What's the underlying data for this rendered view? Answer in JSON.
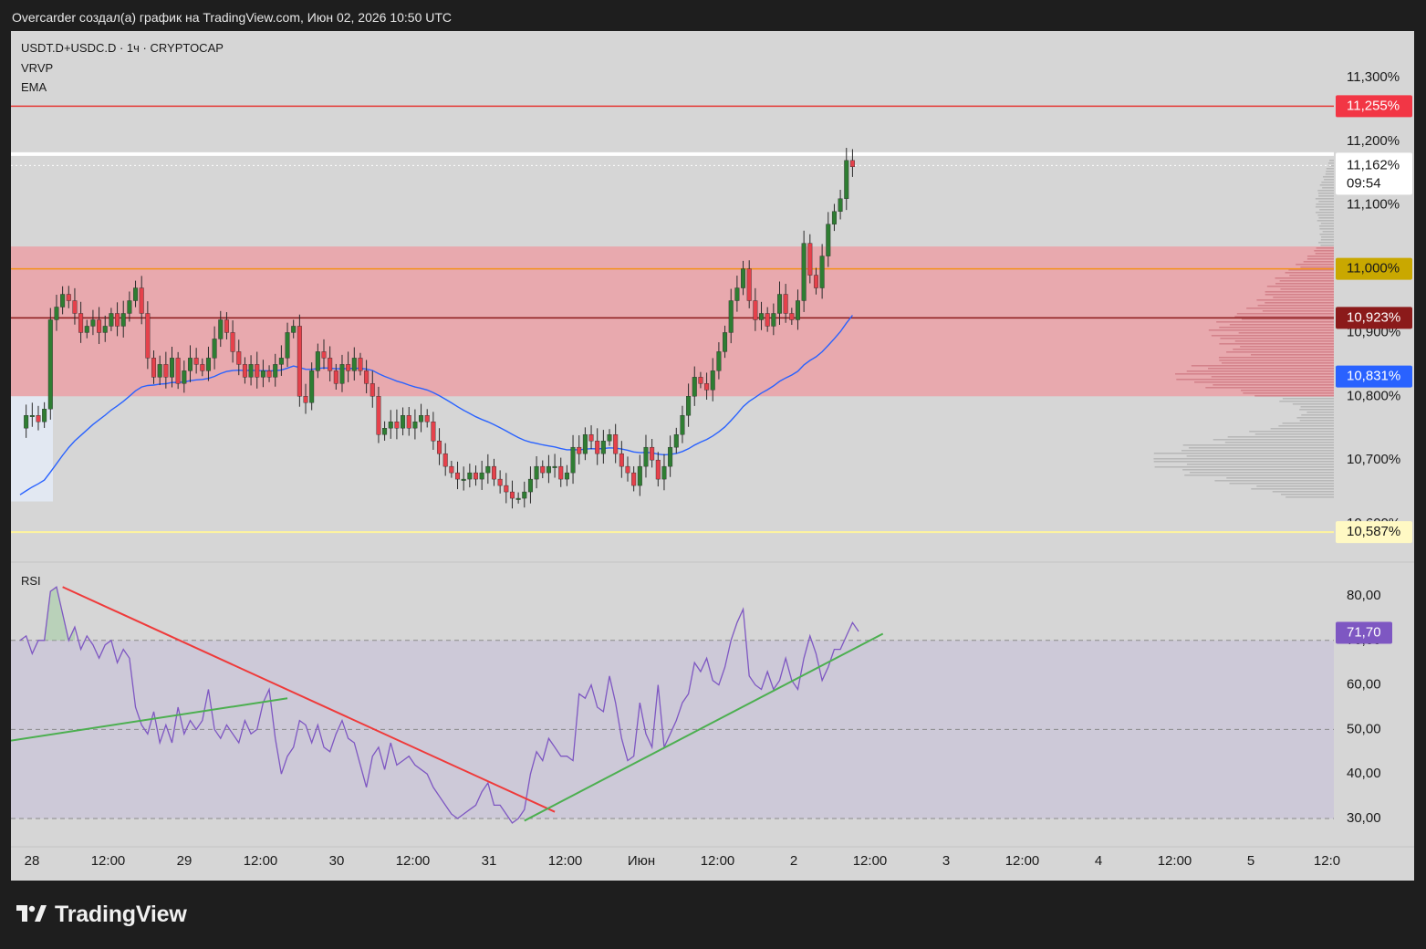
{
  "header": {
    "attribution": "Overcarder создал(а) график на TradingView.com, Июн 02, 2026 10:50 UTC"
  },
  "legend": {
    "symbol": "USDT.D+USDC.D · 1ч · CRYPTOCAP",
    "indicator_1": "VRVP",
    "indicator_2": "EMA",
    "rsi_label": "RSI"
  },
  "footer": {
    "brand": "TradingView"
  },
  "colors": {
    "panel_bg": "#d6d6d6",
    "up": "#2e7d32",
    "down": "#e5414b",
    "ema": "#2962ff",
    "rsi": "#7e57c2",
    "resistance_zone": "#f48a93",
    "line_11255": "#e53935",
    "line_11000": "#f5921b",
    "line_10923": "#8b1a1a",
    "line_10587": "#fff59d",
    "trend_red": "#ef3a3a",
    "trend_green": "#4caf50"
  },
  "chart_data": [
    {
      "type": "candlestick",
      "symbol": "USDT.D+USDC.D",
      "interval": "1ч",
      "exchange": "CRYPTOCAP",
      "y_unit": "%",
      "ylim": [
        10.6,
        11.32
      ],
      "price_ticks": [
        "11,300%",
        "11,200%",
        "11,100%",
        "11,000%",
        "10,900%",
        "10,800%",
        "10,700%",
        "10,600%"
      ],
      "time_ticks": [
        "28",
        "12:00",
        "29",
        "12:00",
        "30",
        "12:00",
        "31",
        "12:00",
        "Июн",
        "12:00",
        "2",
        "12:00",
        "3",
        "12:00",
        "4",
        "12:00",
        "5",
        "12:0"
      ],
      "price_labels": [
        {
          "value": 11.255,
          "text": "11,255%"
        },
        {
          "value": 11.162,
          "text": "11,162%",
          "countdown": "09:54"
        },
        {
          "value": 11.0,
          "text": "11,000%"
        },
        {
          "value": 10.923,
          "text": "10,923%"
        },
        {
          "value": 10.831,
          "text": "10,831%"
        },
        {
          "value": 10.587,
          "text": "10,587%"
        }
      ],
      "horizontal_lines": [
        11.255,
        11.18,
        11.0,
        10.923,
        10.587
      ],
      "resistance_zone": [
        10.8,
        11.035
      ],
      "closes": [
        10.75,
        10.77,
        10.77,
        10.76,
        10.78,
        10.92,
        10.94,
        10.96,
        10.95,
        10.93,
        10.9,
        10.91,
        10.92,
        10.9,
        10.91,
        10.93,
        10.91,
        10.93,
        10.95,
        10.97,
        10.93,
        10.86,
        10.83,
        10.85,
        10.83,
        10.86,
        10.82,
        10.84,
        10.86,
        10.85,
        10.84,
        10.86,
        10.89,
        10.92,
        10.9,
        10.87,
        10.85,
        10.83,
        10.85,
        10.83,
        10.84,
        10.83,
        10.85,
        10.86,
        10.9,
        10.91,
        10.8,
        10.79,
        10.84,
        10.87,
        10.86,
        10.84,
        10.82,
        10.85,
        10.84,
        10.86,
        10.84,
        10.82,
        10.8,
        10.74,
        10.75,
        10.76,
        10.75,
        10.77,
        10.75,
        10.76,
        10.77,
        10.76,
        10.73,
        10.71,
        10.69,
        10.68,
        10.67,
        10.67,
        10.68,
        10.67,
        10.68,
        10.69,
        10.67,
        10.66,
        10.65,
        10.64,
        10.64,
        10.65,
        10.67,
        10.69,
        10.68,
        10.69,
        10.69,
        10.67,
        10.68,
        10.72,
        10.71,
        10.74,
        10.73,
        10.71,
        10.73,
        10.74,
        10.71,
        10.69,
        10.68,
        10.66,
        10.69,
        10.72,
        10.7,
        10.67,
        10.69,
        10.72,
        10.74,
        10.77,
        10.8,
        10.83,
        10.82,
        10.81,
        10.84,
        10.87,
        10.9,
        10.95,
        10.97,
        11.0,
        10.95,
        10.92,
        10.93,
        10.91,
        10.93,
        10.96,
        10.93,
        10.92,
        10.95,
        11.04,
        10.99,
        10.97,
        11.02,
        11.07,
        11.09,
        11.11,
        11.17,
        11.16
      ]
    },
    {
      "type": "line",
      "name": "RSI",
      "ylim": [
        27,
        84
      ],
      "ticks": [
        "80,00",
        "70,00",
        "60,00",
        "50,00",
        "40,00",
        "30,00"
      ],
      "band": [
        30,
        70
      ],
      "current": "71,70",
      "values": [
        70,
        71,
        67,
        70,
        70,
        81,
        82,
        76,
        70,
        73,
        68,
        71,
        69,
        66,
        69,
        70,
        65,
        68,
        66,
        55,
        51,
        49,
        54,
        47,
        51,
        47,
        55,
        49,
        52,
        50,
        52,
        59,
        50,
        48,
        51,
        49,
        47,
        52,
        49,
        50,
        56,
        59,
        48,
        40,
        44,
        46,
        52,
        51,
        47,
        51,
        46,
        45,
        49,
        52,
        48,
        47,
        42,
        37,
        44,
        46,
        41,
        47,
        42,
        43,
        44,
        42,
        41,
        40,
        37,
        35,
        33,
        31,
        30,
        31,
        32,
        33,
        36,
        38,
        33,
        33,
        31,
        29,
        30,
        32,
        40,
        45,
        43,
        48,
        46,
        44,
        44,
        43,
        58,
        57,
        60,
        55,
        54,
        62,
        56,
        48,
        43,
        44,
        56,
        49,
        46,
        60,
        46,
        49,
        52,
        56,
        58,
        65,
        63,
        66,
        61,
        60,
        64,
        70,
        74,
        77,
        62,
        60,
        59,
        63,
        59,
        61,
        66,
        61,
        59,
        66,
        71,
        67,
        61,
        64,
        68,
        68,
        71,
        74,
        72
      ]
    }
  ]
}
